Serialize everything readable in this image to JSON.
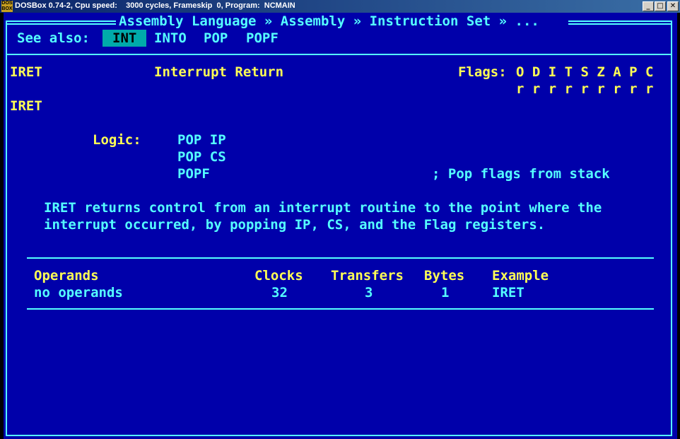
{
  "window": {
    "title": "DOSBox 0.74-2, Cpu speed:    3000 cycles, Frameskip  0, Program:  NCMAIN",
    "minimize_glyph": "_",
    "maximize_glyph": "□",
    "close_glyph": "✕",
    "app_icon": "dosbox-icon"
  },
  "colors": {
    "background": "#0000aa",
    "cyan": "#55ffff",
    "yellow": "#ffff55",
    "highlight_bg": "#00aaaa"
  },
  "header": {
    "breadcrumb": "Assembly Language » Assembly » Instruction Set » ..."
  },
  "see_also": {
    "label": "See also:",
    "links": [
      "INT",
      "INTO",
      "POP",
      "POPF"
    ],
    "selected": "INT"
  },
  "instruction": {
    "mnemonic": "IRET",
    "description": "Interrupt Return",
    "flags_label": "Flags:",
    "flag_names": "O D I T S Z A P C",
    "flag_values": "r r r r r r r r r",
    "syntax": "IRET"
  },
  "logic": {
    "label": "Logic:",
    "lines": [
      "POP IP",
      "POP CS",
      "POPF"
    ],
    "comment": "; Pop flags from stack"
  },
  "explanation": [
    "IRET returns control from an interrupt routine to the point where the",
    "interrupt occurred, by popping IP, CS, and the Flag registers."
  ],
  "table": {
    "headers": {
      "operands": "Operands",
      "clocks": "Clocks",
      "transfers": "Transfers",
      "bytes": "Bytes",
      "example": "Example"
    },
    "rows": [
      {
        "operands": "no operands",
        "clocks": "32",
        "transfers": "3",
        "bytes": "1",
        "example": "IRET"
      }
    ]
  }
}
